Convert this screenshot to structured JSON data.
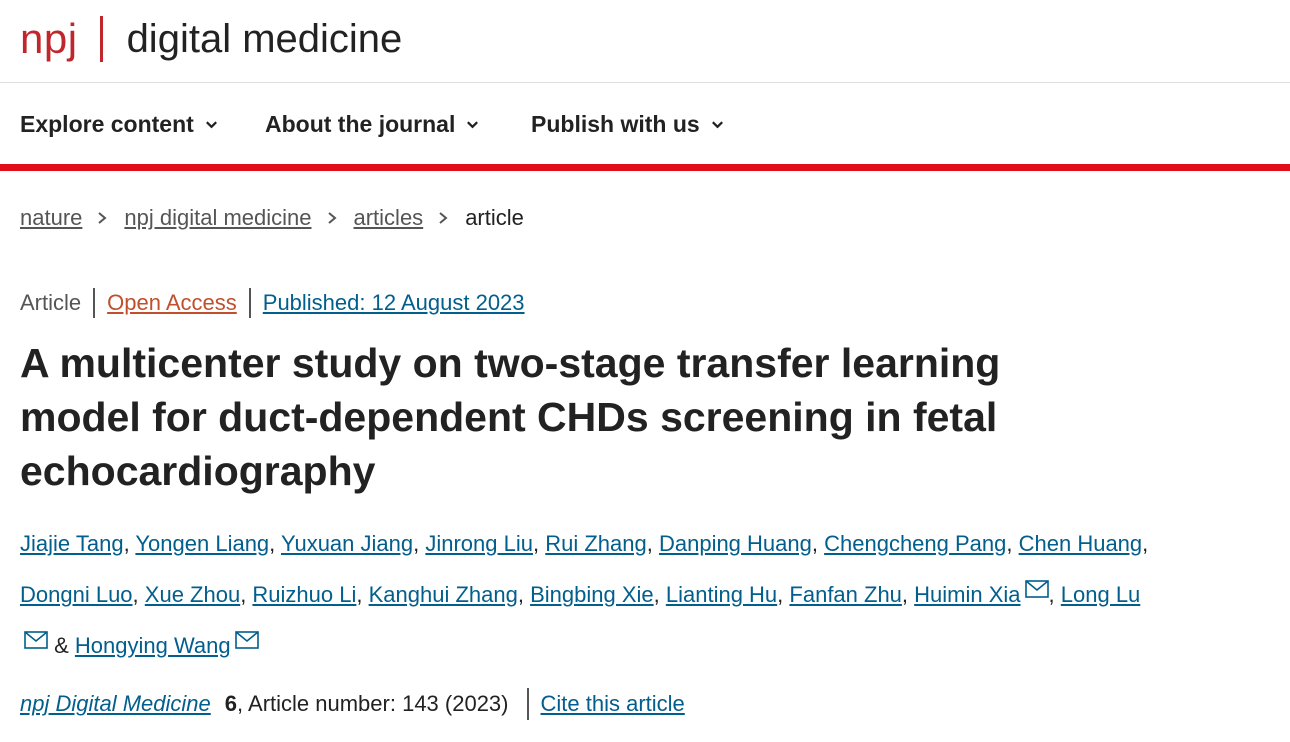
{
  "header": {
    "logo_npj": "npj",
    "logo_title": "digital medicine",
    "brand_color": "#c0272d"
  },
  "nav": {
    "items": [
      {
        "label": "Explore content",
        "icon": "chevron-down-icon"
      },
      {
        "label": "About the journal",
        "icon": "chevron-down-icon"
      },
      {
        "label": "Publish with us",
        "icon": "chevron-down-icon"
      }
    ],
    "rule_color": "#e10e1a"
  },
  "breadcrumb": {
    "items": [
      "nature",
      "npj digital medicine",
      "articles",
      "article"
    ],
    "separator_icon": "chevron-right-icon"
  },
  "article": {
    "type": "Article",
    "access": "Open Access",
    "published": "Published: 12 August 2023",
    "title": "A multicenter study on two-stage transfer learning model for duct-dependent CHDs screening in fetal echocardiography",
    "authors": [
      "Jiajie Tang",
      "Yongen Liang",
      "Yuxuan Jiang",
      "Jinrong Liu",
      "Rui Zhang",
      "Danping Huang",
      "Chengcheng Pang",
      "Chen Huang",
      "Dongni Luo",
      "Xue Zhou",
      "Ruizhuo Li",
      "Kanghui Zhang",
      "Bingbing Xie",
      "Lianting Hu",
      "Fanfan Zhu",
      "Huimin Xia",
      "Long Lu",
      "Hongying Wang"
    ],
    "author_separator": ", ",
    "author_final_separator": " & ",
    "corresponding_icon": "envelope-icon",
    "journal": "npj Digital Medicine",
    "volume": "6",
    "article_number": ", Article number: 143 (2023)",
    "cite_label": "Cite this article"
  },
  "colors": {
    "link": "#025e8d",
    "open_access": "#c0502d",
    "text": "#222222",
    "muted": "#555555"
  }
}
